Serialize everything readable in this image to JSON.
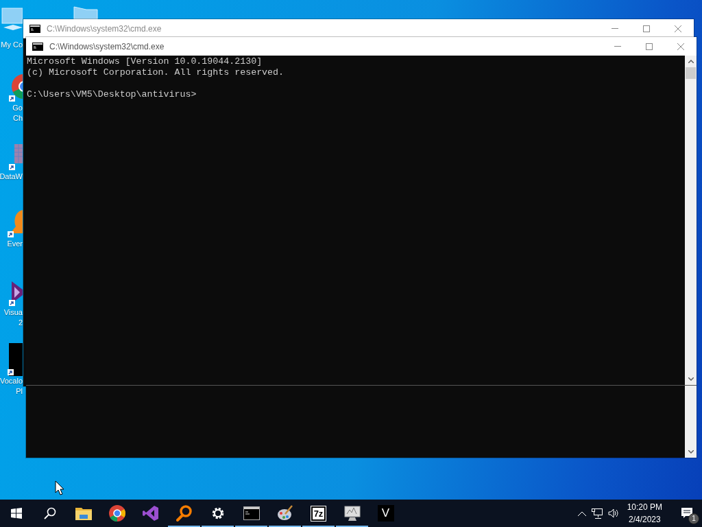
{
  "desktop_icons": [
    {
      "kind": "computer",
      "lines": [
        "My Co"
      ]
    },
    {
      "kind": "folder"
    },
    {
      "kind": "browser",
      "lines": [
        "Go",
        "Ch"
      ]
    },
    {
      "kind": "grid",
      "lines": [
        "DataW"
      ]
    },
    {
      "kind": "blob",
      "lines": [
        "Ever"
      ]
    },
    {
      "kind": "ribbon",
      "lines": [
        "Visua",
        "2"
      ]
    },
    {
      "kind": "dark",
      "lines": [
        "Vocalo",
        "Pl"
      ]
    }
  ],
  "windows": [
    {
      "title": "C:\\Windows\\system32\\cmd.exe",
      "active": false
    },
    {
      "title": "C:\\Windows\\system32\\cmd.exe",
      "active": true,
      "console": [
        [
          "Microsoft Windows [Version 10.0.19044.2130]",
          "(c) Microsoft Corporation. All rights reserved."
        ],
        [
          "C:\\Users\\VM5\\Desktop\\antivirus>"
        ]
      ]
    }
  ],
  "taskbar": {
    "apps": [
      {
        "kind": "start",
        "running": false
      },
      {
        "kind": "search",
        "running": false
      },
      {
        "kind": "folder",
        "running": false
      },
      {
        "kind": "browser",
        "running": false
      },
      {
        "kind": "ribbon",
        "running": false
      },
      {
        "kind": "magnifier",
        "running": true
      },
      {
        "kind": "gear",
        "running": true
      },
      {
        "kind": "terminal",
        "running": true
      },
      {
        "kind": "palette",
        "running": true
      },
      {
        "kind": "archive",
        "label": "7z",
        "running": true
      },
      {
        "kind": "monitor",
        "running": true
      },
      {
        "kind": "letter",
        "label": "V",
        "running": false
      }
    ],
    "clock_time": "10:20 PM",
    "clock_date": "2/4/2023",
    "notification_count": "1"
  }
}
